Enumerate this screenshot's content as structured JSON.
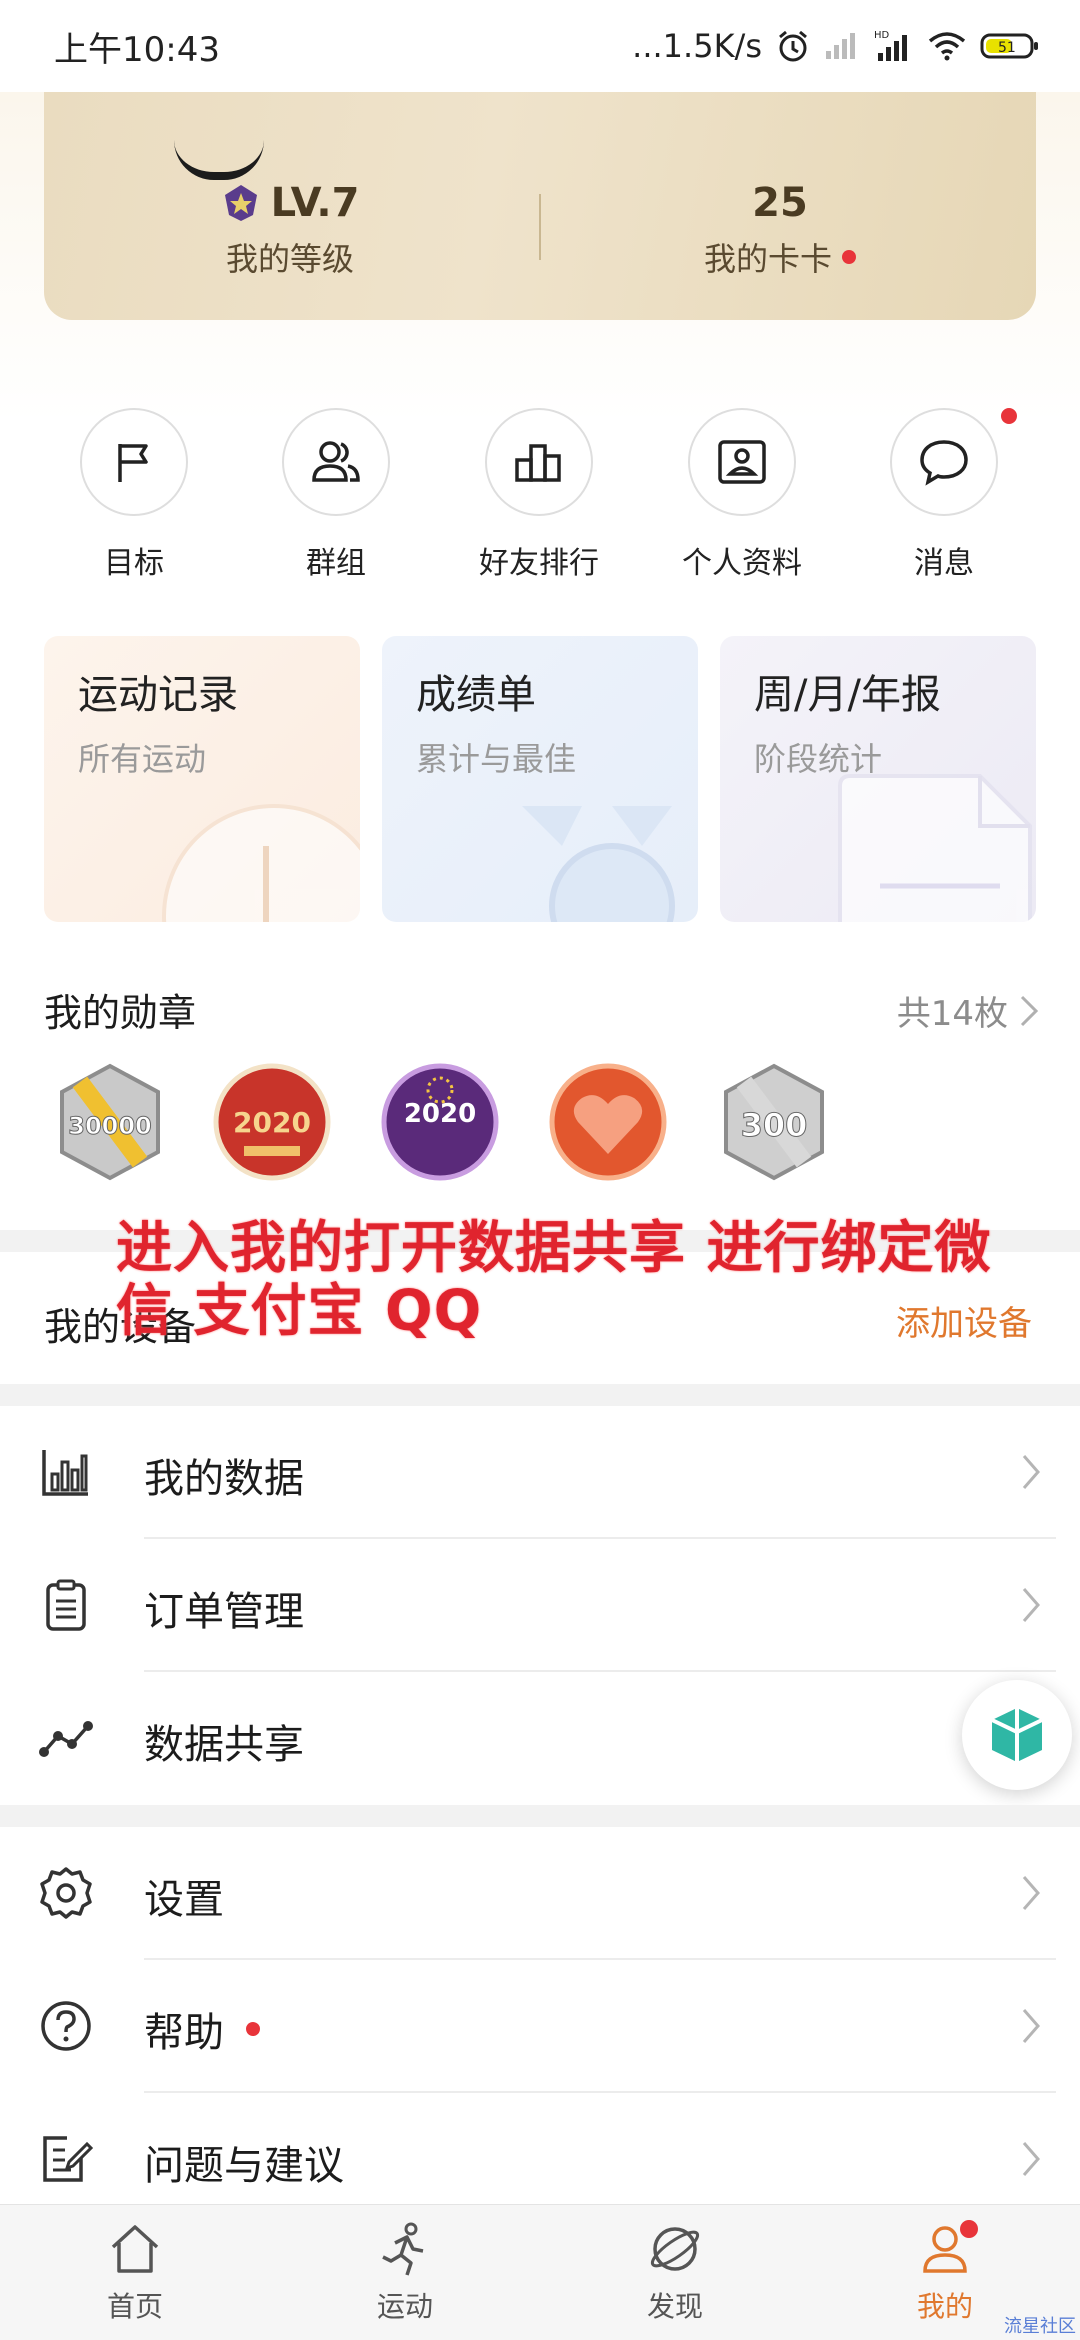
{
  "status_bar": {
    "time": "上午10:43",
    "network_speed": "...1.5K/s",
    "battery": "51"
  },
  "profile": {
    "level_value": "LV.7",
    "level_label": "我的等级",
    "cards_value": "25",
    "cards_label": "我的卡卡"
  },
  "quick_actions": [
    {
      "label": "目标",
      "icon": "flag-icon"
    },
    {
      "label": "群组",
      "icon": "group-icon"
    },
    {
      "label": "好友排行",
      "icon": "ranking-icon"
    },
    {
      "label": "个人资料",
      "icon": "profile-card-icon"
    },
    {
      "label": "消息",
      "icon": "message-icon"
    }
  ],
  "feature_cards": [
    {
      "title": "运动记录",
      "subtitle": "所有运动"
    },
    {
      "title": "成绩单",
      "subtitle": "累计与最佳"
    },
    {
      "title": "周/月/年报",
      "subtitle": "阶段统计"
    }
  ],
  "medals": {
    "title": "我的勋章",
    "count": "共14枚",
    "items": [
      {
        "name": "medal-30000",
        "text": "30000"
      },
      {
        "name": "medal-2020-new-year-red",
        "text": "2020"
      },
      {
        "name": "medal-2020-happy-new-year",
        "text": "2020"
      },
      {
        "name": "medal-heart",
        "text": ""
      },
      {
        "name": "medal-300",
        "text": "300"
      }
    ]
  },
  "devices": {
    "title": "我的设备",
    "add_label": "添加设备"
  },
  "overlay_text": "进入我的打开数据共享 进行绑定微信 支付宝 QQ",
  "menu": [
    {
      "label": "我的数据",
      "icon": "bar-chart-icon"
    },
    {
      "label": "订单管理",
      "icon": "clipboard-icon"
    },
    {
      "label": "数据共享",
      "icon": "share-nodes-icon"
    },
    {
      "label": "设置",
      "icon": "gear-icon"
    },
    {
      "label": "帮助",
      "icon": "help-icon"
    },
    {
      "label": "问题与建议",
      "icon": "feedback-icon"
    }
  ],
  "bottom_nav": [
    {
      "label": "首页",
      "icon": "home-icon"
    },
    {
      "label": "运动",
      "icon": "running-icon"
    },
    {
      "label": "发现",
      "icon": "discover-icon"
    },
    {
      "label": "我的",
      "icon": "person-icon",
      "active": true
    }
  ],
  "watermark": "流星社区",
  "colors": {
    "accent": "#e0782e",
    "badge": "#e8343a",
    "overlay": "#e0242e",
    "gold_card": "#ece0c6"
  }
}
